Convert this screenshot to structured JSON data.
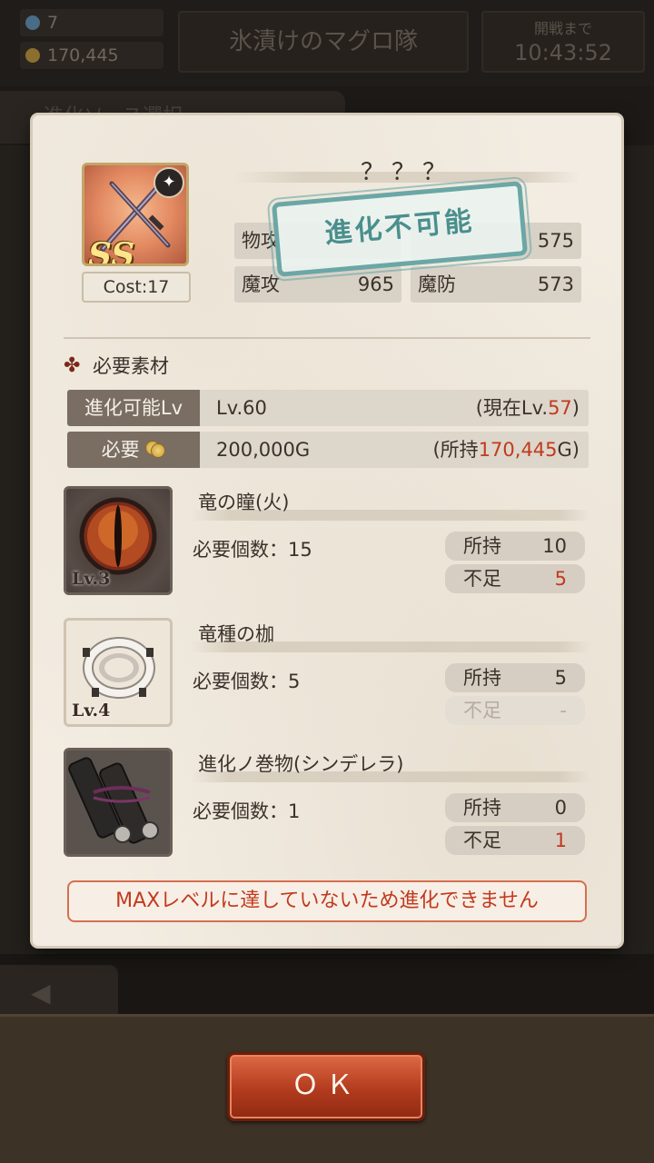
{
  "header": {
    "gems": "7",
    "gold": "170,445",
    "team_name": "氷漬けのマグロ隊",
    "timer_label": "開戦まで",
    "timer_value": "10:43:52",
    "bg_strip": "進化ソース選択"
  },
  "unit": {
    "name": "？？？",
    "rank": "SS",
    "cost": "Cost:17",
    "weapon_type_icon": "mace-icon",
    "stats": {
      "phys_atk_label": "物攻",
      "phys_def_value": "575",
      "mag_atk_label": "魔攻",
      "mag_atk_value": "965",
      "mag_def_label": "魔防",
      "mag_def_value": "573"
    },
    "stamp": "進化不可能"
  },
  "requirements": {
    "title": "必要素材",
    "lv_label": "進化可能Lv",
    "lv_value": "Lv.60",
    "lv_current_prefix": "(現在Lv.",
    "lv_current": "57",
    "lv_current_suffix": ")",
    "gold_label": "必要",
    "gold_value": "200,000G",
    "gold_owned_prefix": "(所持",
    "gold_owned": "170,445",
    "gold_owned_suffix": "G)"
  },
  "materials": [
    {
      "name": "竜の瞳(火)",
      "level": "Lv.3",
      "req_label": "必要個数：15",
      "owned_label": "所持",
      "owned": "10",
      "short_label": "不足",
      "short": "5",
      "icon": "dragon-eye-icon"
    },
    {
      "name": "竜種の枷",
      "level": "Lv.4",
      "req_label": "必要個数：5",
      "owned_label": "所持",
      "owned": "5",
      "short_label": "不足",
      "short": "-",
      "icon": "shackle-icon"
    },
    {
      "name": "進化ノ巻物(シンデレラ)",
      "level": "",
      "req_label": "必要個数：1",
      "owned_label": "所持",
      "owned": "0",
      "short_label": "不足",
      "short": "1",
      "icon": "scroll-icon"
    }
  ],
  "warning": "MAXレベルに達していないため進化できません",
  "ok_label": "ＯＫ",
  "colors": {
    "accent_red": "#c23a1e",
    "stamp_teal": "#6aa7a6",
    "ok_button": "#b33b1e"
  }
}
